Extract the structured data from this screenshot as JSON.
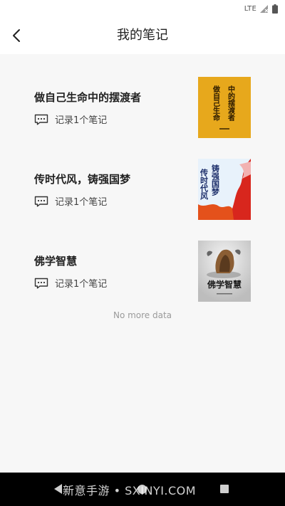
{
  "status_bar": {
    "network": "LTE"
  },
  "header": {
    "title": "我的笔记",
    "back_icon": "chevron-left-icon"
  },
  "books": [
    {
      "title": "做自己生命中的摆渡者",
      "notes_label": "记录1个笔记",
      "cover_color": "#e7a81c",
      "cover_text": [
        "做自己生命",
        "中的摆渡者"
      ]
    },
    {
      "title": "传时代风，铸强国梦",
      "notes_label": "记录1个笔记",
      "cover_color": "#e8f2fb",
      "cover_text": [
        "传时代风",
        "铸强国梦"
      ]
    },
    {
      "title": "佛学智慧",
      "notes_label": "记录1个笔记",
      "cover_color": "#d9d9d9",
      "cover_text": [
        "佛学智慧"
      ]
    }
  ],
  "footer": {
    "no_more_text": "No more data"
  },
  "watermark": "新意手游 • SXINYI.COM"
}
